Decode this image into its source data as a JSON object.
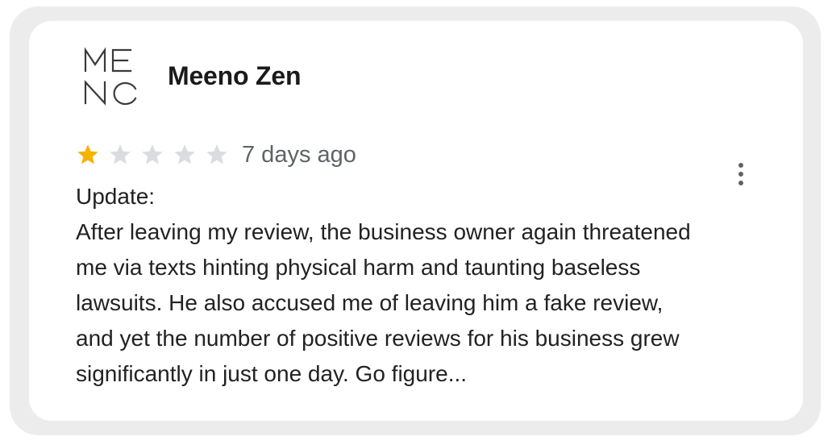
{
  "review": {
    "author_name": "Meeno Zen",
    "avatar": {
      "icon": "meno-logo-icon",
      "letters_top": "ME",
      "letters_bottom": "NO"
    },
    "rating": 1,
    "max_rating": 5,
    "timestamp": "7 days ago",
    "more_options_icon": "more-vertical-icon",
    "body_lines": [
      "Update:",
      "After leaving my review, the business owner again threatened",
      "me via texts hinting physical harm and taunting baseless",
      "lawsuits. He also accused me of leaving him a fake review,",
      "and yet the number of positive reviews for his business grew",
      "significantly in just one day. Go figure..."
    ]
  },
  "colors": {
    "star_filled": "#f5b400",
    "star_empty": "#dadce0",
    "card_frame": "#ececec",
    "text_primary": "#222222",
    "text_secondary": "#5f6368"
  }
}
